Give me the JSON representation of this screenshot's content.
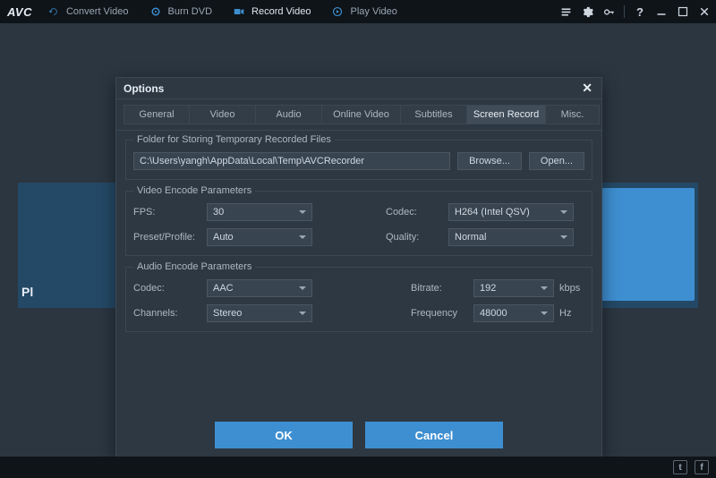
{
  "app": {
    "logo": "AVC"
  },
  "nav": {
    "items": [
      {
        "label": "Convert Video"
      },
      {
        "label": "Burn DVD"
      },
      {
        "label": "Record Video"
      },
      {
        "label": "Play Video"
      }
    ]
  },
  "stage": {
    "left_text": "Pl"
  },
  "modal": {
    "title": "Options",
    "tabs": [
      "General",
      "Video",
      "Audio",
      "Online Video",
      "Subtitles",
      "Screen Record",
      "Misc."
    ],
    "folder_group": {
      "legend": "Folder for Storing Temporary Recorded Files",
      "path": "C:\\Users\\yangh\\AppData\\Local\\Temp\\AVCRecorder",
      "browse": "Browse...",
      "open": "Open..."
    },
    "video_group": {
      "legend": "Video Encode Parameters",
      "fps_label": "FPS:",
      "fps_value": "30",
      "preset_label": "Preset/Profile:",
      "preset_value": "Auto",
      "codec_label": "Codec:",
      "codec_value": "H264 (Intel QSV)",
      "quality_label": "Quality:",
      "quality_value": "Normal"
    },
    "audio_group": {
      "legend": "Audio Encode Parameters",
      "codec_label": "Codec:",
      "codec_value": "AAC",
      "channels_label": "Channels:",
      "channels_value": "Stereo",
      "bitrate_label": "Bitrate:",
      "bitrate_value": "192",
      "bitrate_unit": "kbps",
      "frequency_label": "Frequency",
      "frequency_value": "48000",
      "frequency_unit": "Hz"
    },
    "buttons": {
      "ok": "OK",
      "cancel": "Cancel"
    }
  },
  "title_actions": {
    "help": "?"
  },
  "social": {
    "twitter": "t",
    "facebook": "f"
  }
}
